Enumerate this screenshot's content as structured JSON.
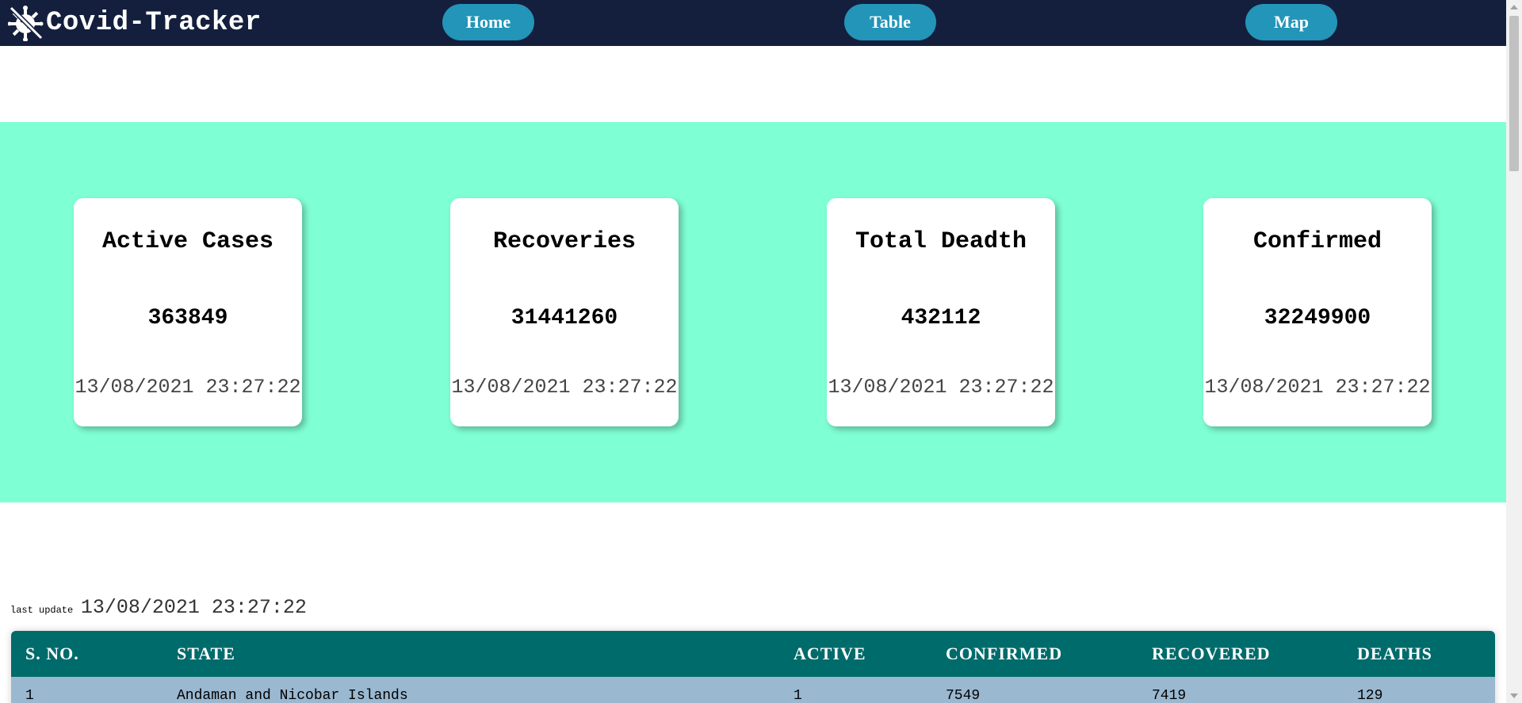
{
  "navbar": {
    "brand_icon": "covid-virus-icon",
    "brand_title": "Covid-Tracker",
    "links": [
      {
        "label": "Home"
      },
      {
        "label": "Table"
      },
      {
        "label": "Map"
      }
    ]
  },
  "colors": {
    "navbar_bg": "#141f3d",
    "nav_button": "#2295b8",
    "stats_band": "#7fffd4",
    "table_header": "#006b6b",
    "table_row": "#9ab8d0"
  },
  "stats": [
    {
      "title": "Active Cases",
      "value": "363849",
      "date": "13/08/2021 23:27:22"
    },
    {
      "title": "Recoveries",
      "value": "31441260",
      "date": "13/08/2021 23:27:22"
    },
    {
      "title": "Total Deadth",
      "value": "432112",
      "date": "13/08/2021 23:27:22"
    },
    {
      "title": "Confirmed",
      "value": "32249900",
      "date": "13/08/2021 23:27:22"
    }
  ],
  "last_update": {
    "label": "last update",
    "value": "13/08/2021 23:27:22"
  },
  "table": {
    "headers": [
      "S. NO.",
      "STATE",
      "ACTIVE",
      "CONFIRMED",
      "RECOVERED",
      "DEATHS"
    ],
    "rows": [
      [
        "1",
        "Andaman and Nicobar Islands",
        "1",
        "7549",
        "7419",
        "129"
      ]
    ]
  }
}
